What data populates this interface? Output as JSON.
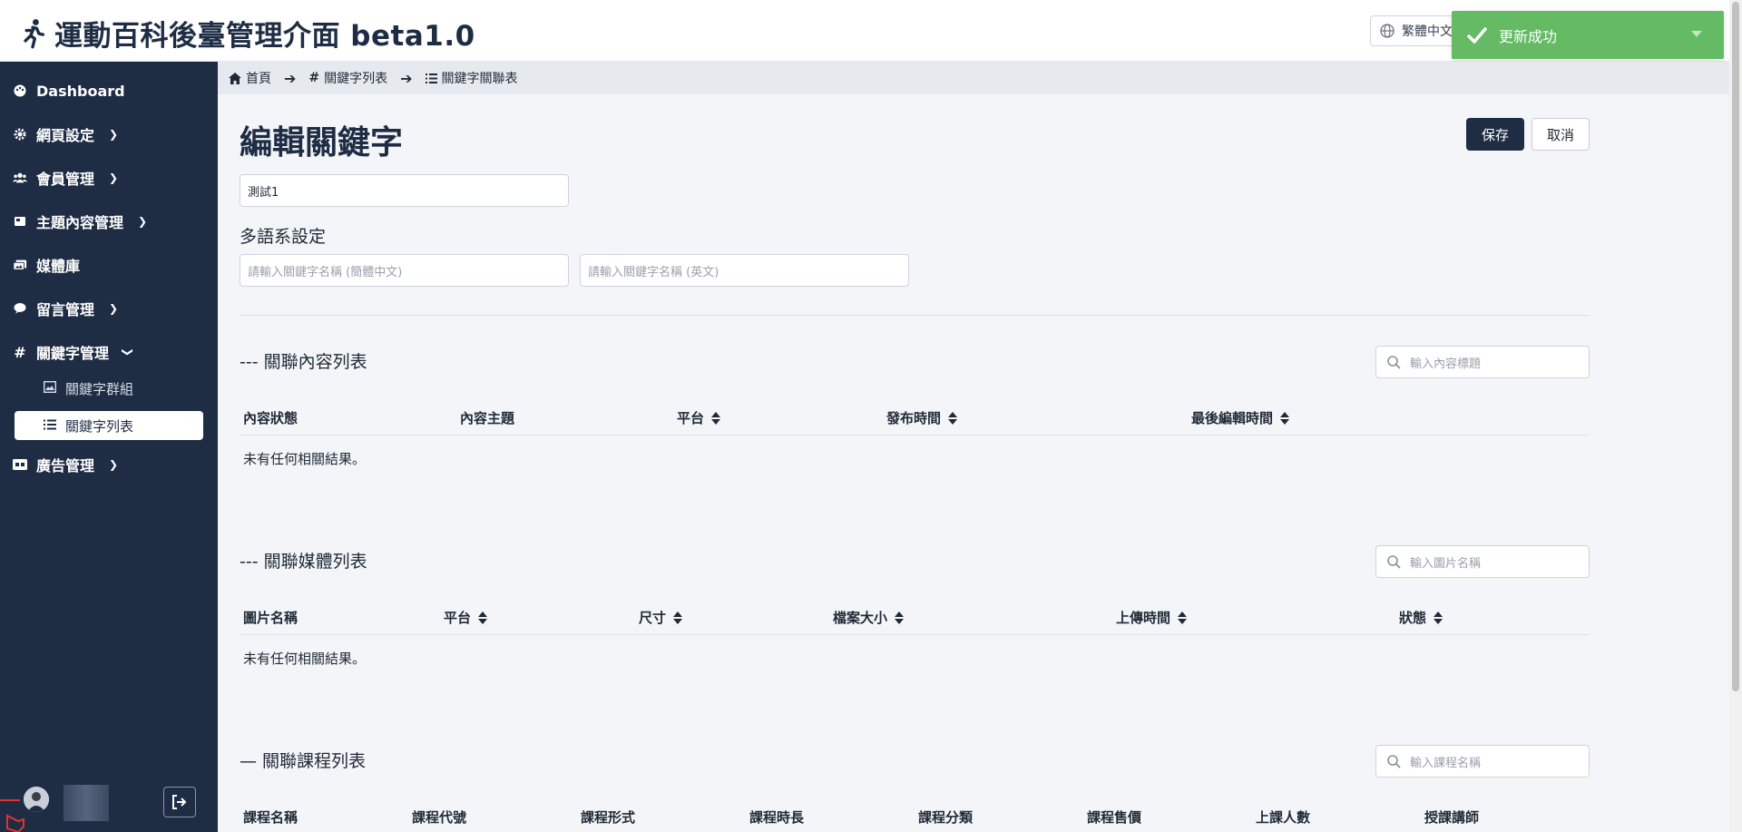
{
  "header": {
    "title": "運動百科後臺管理介面 beta1.0",
    "language": "繁體中文"
  },
  "toast": {
    "message": "更新成功",
    "color": "#5cb85c"
  },
  "sidebar": {
    "items": [
      {
        "label": "Dashboard",
        "icon": "palette-icon"
      },
      {
        "label": "網頁設定",
        "icon": "gear-icon"
      },
      {
        "label": "會員管理",
        "icon": "users-icon"
      },
      {
        "label": "主題內容管理",
        "icon": "book-icon"
      },
      {
        "label": "媒體庫",
        "icon": "images-icon"
      },
      {
        "label": "留言管理",
        "icon": "comment-icon"
      },
      {
        "label": "關鍵字管理",
        "icon": "hashtag-icon"
      },
      {
        "label": "廣告管理",
        "icon": "ad-icon"
      }
    ],
    "subitems": [
      {
        "label": "關鍵字群組",
        "icon": "image-icon"
      },
      {
        "label": "關鍵字列表",
        "icon": "list-icon"
      }
    ]
  },
  "breadcrumb": {
    "home": "首頁",
    "keywords": "關鍵字列表",
    "relations": "關鍵字關聯表"
  },
  "page": {
    "title": "編輯關鍵字",
    "save_label": "保存",
    "cancel_label": "取消",
    "keyword_value": "測試1",
    "multilang_title": "多語系設定",
    "placeholder_sc": "請輸入關鍵字名稱 (簡體中文)",
    "placeholder_en": "請輸入關鍵字名稱 (英文)"
  },
  "content_section": {
    "title": "--- 關聯內容列表",
    "search_placeholder": "輸入內容標題",
    "columns": [
      "內容狀態",
      "內容主題",
      "平台",
      "發布時間",
      "最後編輯時間"
    ],
    "empty": "未有任何相關結果。"
  },
  "media_section": {
    "title": "--- 關聯媒體列表",
    "search_placeholder": "輸入圖片名稱",
    "columns": [
      "圖片名稱",
      "平台",
      "尺寸",
      "檔案大小",
      "上傳時間",
      "狀態"
    ],
    "empty": "未有任何相關結果。"
  },
  "course_section": {
    "title": "— 關聯課程列表",
    "search_placeholder": "輸入課程名稱",
    "columns": [
      "課程名稱",
      "課程代號",
      "課程形式",
      "課程時長",
      "課程分類",
      "課程售價",
      "上課人數",
      "授課講師"
    ]
  },
  "colors": {
    "sidebar": "#1e2c44",
    "primary": "#1e2c44"
  }
}
